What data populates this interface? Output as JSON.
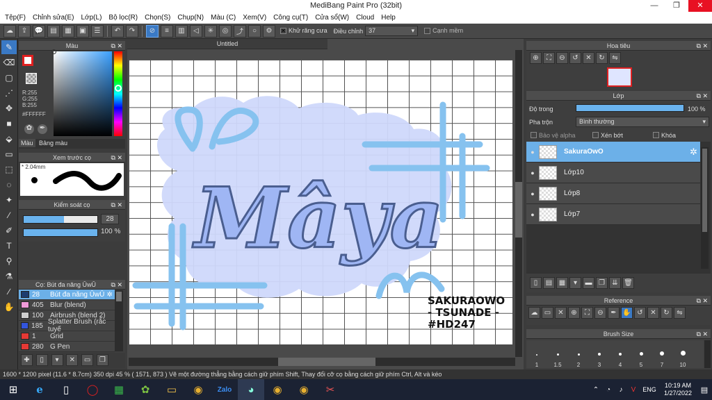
{
  "window": {
    "title": "MediBang Paint Pro (32bit)",
    "min": "—",
    "max": "❐",
    "close": "✕"
  },
  "menu": [
    "Tệp(F)",
    "Chỉnh sửa(E)",
    "Lớp(L)",
    "Bộ lọc(R)",
    "Chọn(S)",
    "Chụp(N)",
    "Màu (C)",
    "Xem(V)",
    "Công cụ(T)",
    "Cửa sổ(W)",
    "Cloud",
    "Help"
  ],
  "toolbar": {
    "antialias_label": "Khử răng cưa",
    "adjust_label": "Điều chỉnh",
    "adjust_value": "37",
    "margin_label": "Cạnh mềm"
  },
  "color_panel": {
    "title": "Màu",
    "r": "R:255",
    "g": "G:255",
    "b": "B:255",
    "hex": "#FFFFFF",
    "tab1": "Màu",
    "tab2": "Bảng màu"
  },
  "brush_preview": {
    "title": "Xem trước cọ",
    "size": "2.04mm"
  },
  "brush_control": {
    "title": "Kiểm soát cọ",
    "size_value": "28",
    "opacity_value": "100 %",
    "size_fraction": 0.55,
    "opacity_fraction": 1.0
  },
  "brush_list": {
    "title": "Cọ: Bút đa năng ŪwŪ",
    "items": [
      {
        "size": "28",
        "name": "Bút đa năng ŪwŪ",
        "color": "#1d3c6e",
        "selected": true
      },
      {
        "size": "405",
        "name": "Blur (blend)",
        "color": "#f09ad8",
        "selected": false
      },
      {
        "size": "100",
        "name": "Airbrush (blend 2)",
        "color": "#cfcfcf",
        "selected": false
      },
      {
        "size": "185",
        "name": "Splatter Brush (rắc tuyế",
        "color": "#3355dd",
        "selected": false
      },
      {
        "size": "1",
        "name": "Grid",
        "color": "#e53935",
        "selected": false
      },
      {
        "size": "280",
        "name": "G Pen",
        "color": "#e53935",
        "selected": false
      }
    ]
  },
  "canvas": {
    "tab": "Untitled",
    "art_title": "Mâya",
    "signature": [
      "SAKURAOWO",
      "- TSUNADE -",
      "#HD247"
    ]
  },
  "navigator": {
    "title": "Hoa tiêu"
  },
  "layer_panel": {
    "title": "Lớp",
    "opacity_label": "Độ trong",
    "opacity_value": "100 %",
    "opacity_fraction": 1.0,
    "blend_label": "Pha trộn",
    "blend_value": "Bình thường",
    "protect_alpha": "Bảo vệ alpha",
    "clipping": "Xén bớt",
    "lock": "Khóa",
    "layers": [
      {
        "name": "SakuraOwO",
        "selected": true
      },
      {
        "name": "Lớp10",
        "selected": false
      },
      {
        "name": "Lớp8",
        "selected": false
      },
      {
        "name": "Lớp7",
        "selected": false
      }
    ]
  },
  "reference_panel": {
    "title": "Reference"
  },
  "brush_size_panel": {
    "title": "Brush Size",
    "sizes": [
      "1",
      "1.5",
      "2",
      "3",
      "4",
      "5",
      "7",
      "10"
    ]
  },
  "status": {
    "text": "1600 * 1200 pixel  (11.6 * 8.7cm)  350 dpi  45 %  ( 1571, 873 )  Vẽ một đường thẳng bằng cách giữ phím Shift, Thay đổi cỡ cọ bằng cách giữ phím Ctrl, Alt và kéo"
  },
  "taskbar": {
    "time": "10:19 AM",
    "date": "1/27/2022",
    "lang": "ENG"
  }
}
